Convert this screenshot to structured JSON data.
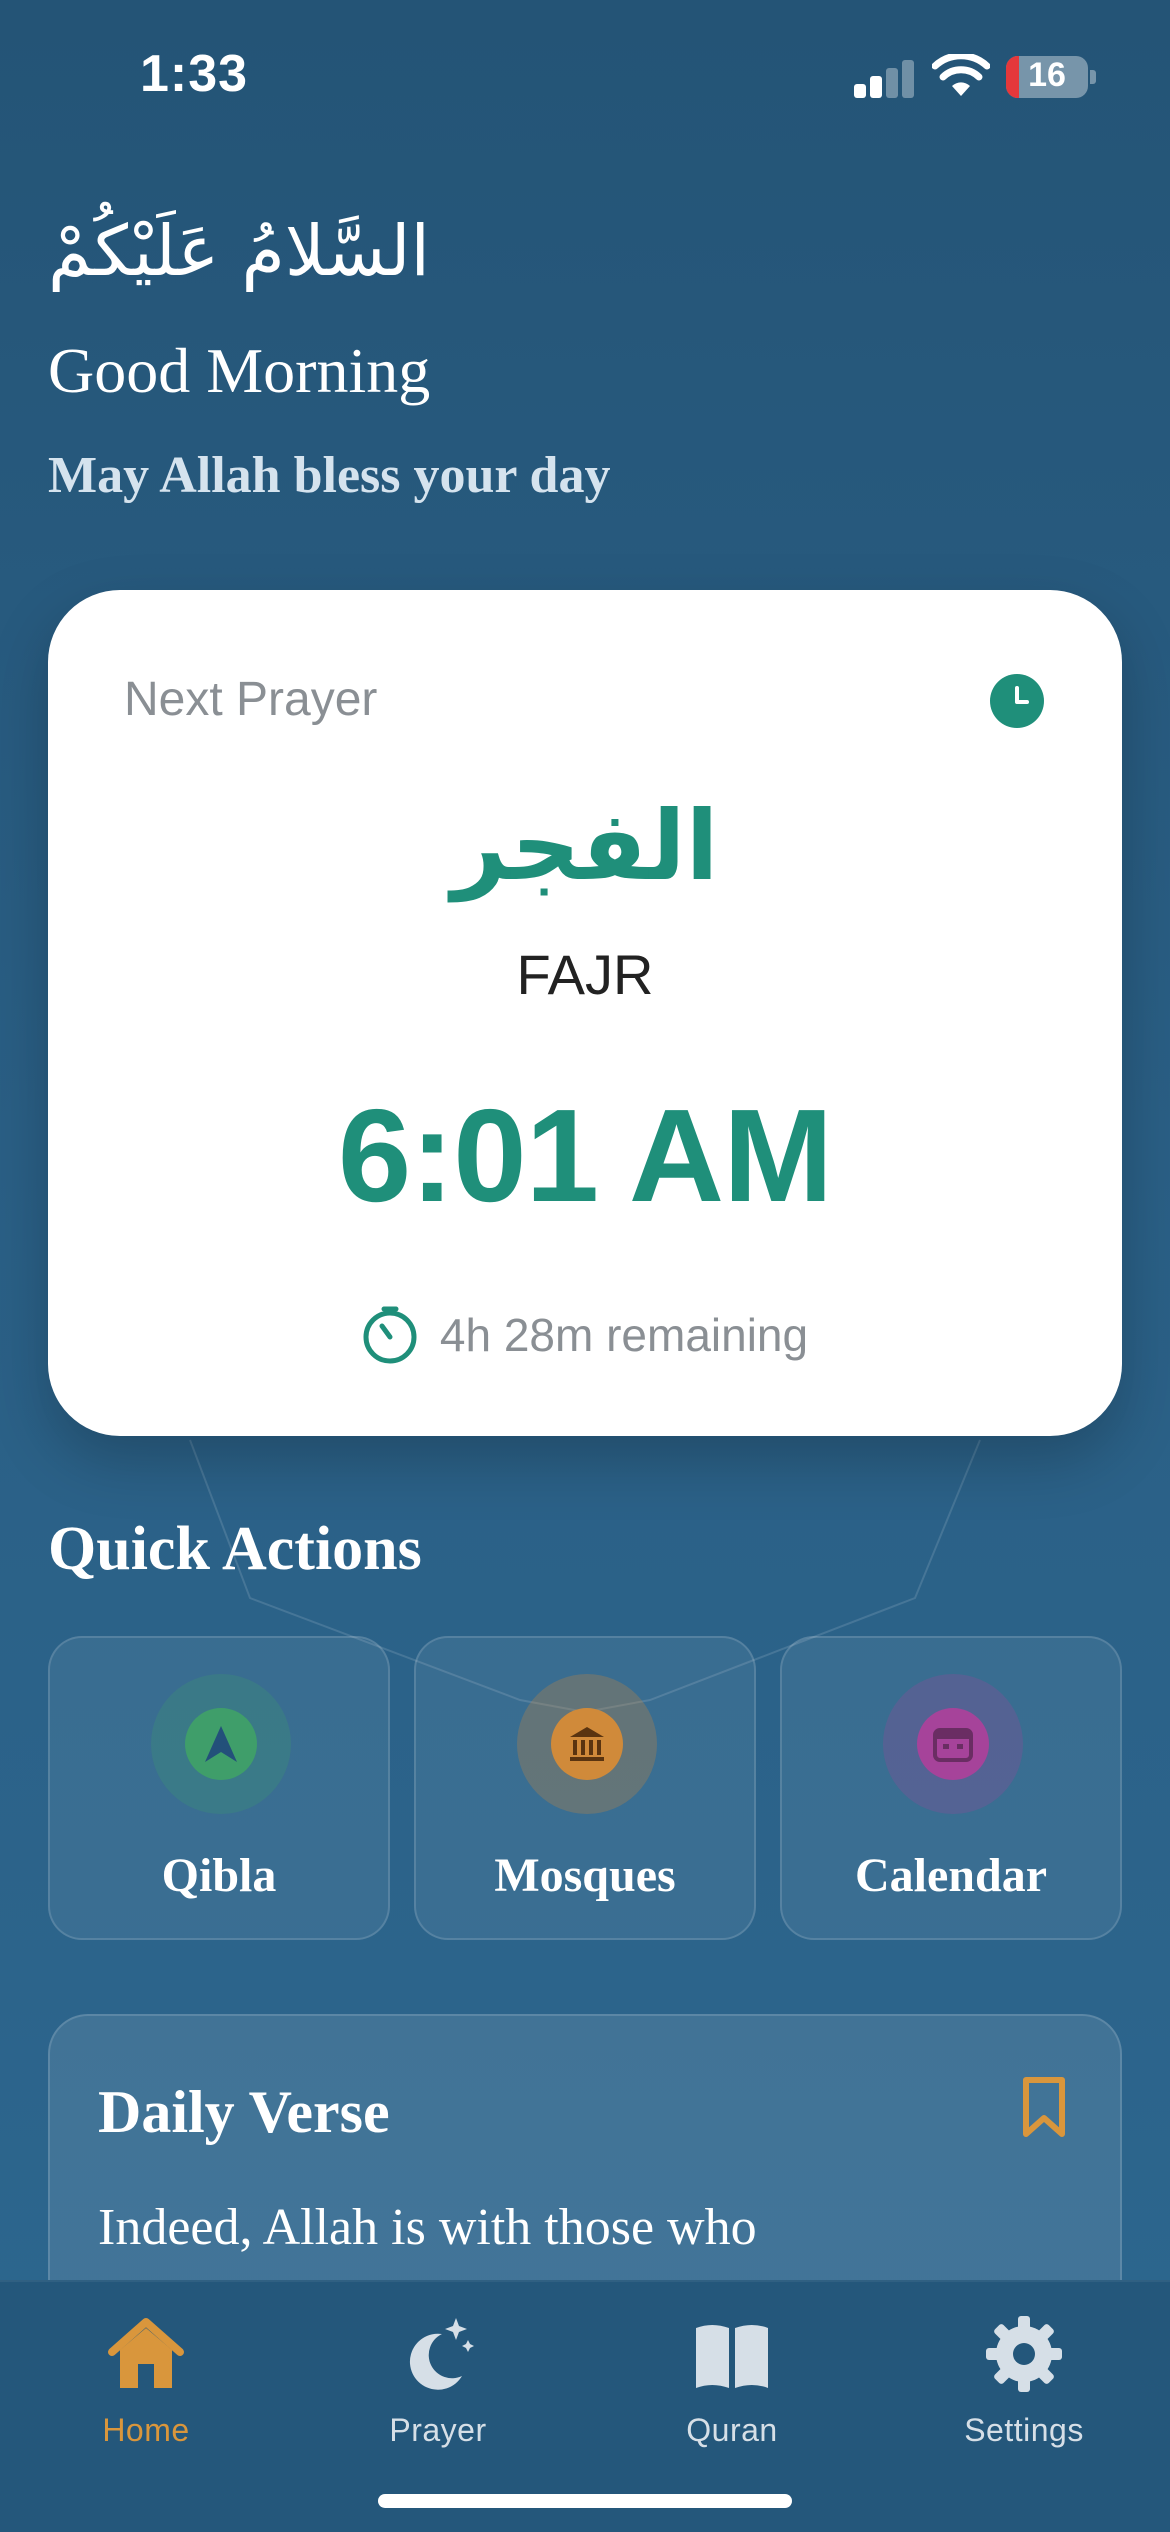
{
  "status_bar": {
    "time": "1:33",
    "battery_percent": "16"
  },
  "greeting": {
    "arabic": "السَّلامُ عَلَيْكُمْ",
    "title": "Good Morning",
    "subtitle": "May Allah bless your day"
  },
  "next_prayer": {
    "label": "Next Prayer",
    "arabic_name": "الفجر",
    "english_name": "FAJR",
    "time": "6:01 AM",
    "remaining": "4h 28m remaining",
    "accent_color": "#1f8f7a"
  },
  "quick_actions": {
    "title": "Quick Actions",
    "items": [
      {
        "label": "Qibla",
        "icon": "compass-arrow-icon",
        "color": "#3f9e6a"
      },
      {
        "label": "Mosques",
        "icon": "mosque-icon",
        "color": "#d08a3a"
      },
      {
        "label": "Calendar",
        "icon": "calendar-icon",
        "color": "#a6439a"
      }
    ]
  },
  "daily_verse": {
    "title": "Daily Verse",
    "text": "Indeed, Allah is with those who",
    "bookmark_color": "#d9963c"
  },
  "tab_bar": {
    "active_color": "#d9963c",
    "items": [
      {
        "label": "Home",
        "icon": "home-icon",
        "active": true
      },
      {
        "label": "Prayer",
        "icon": "moon-stars-icon",
        "active": false
      },
      {
        "label": "Quran",
        "icon": "book-icon",
        "active": false
      },
      {
        "label": "Settings",
        "icon": "gear-icon",
        "active": false
      }
    ]
  }
}
